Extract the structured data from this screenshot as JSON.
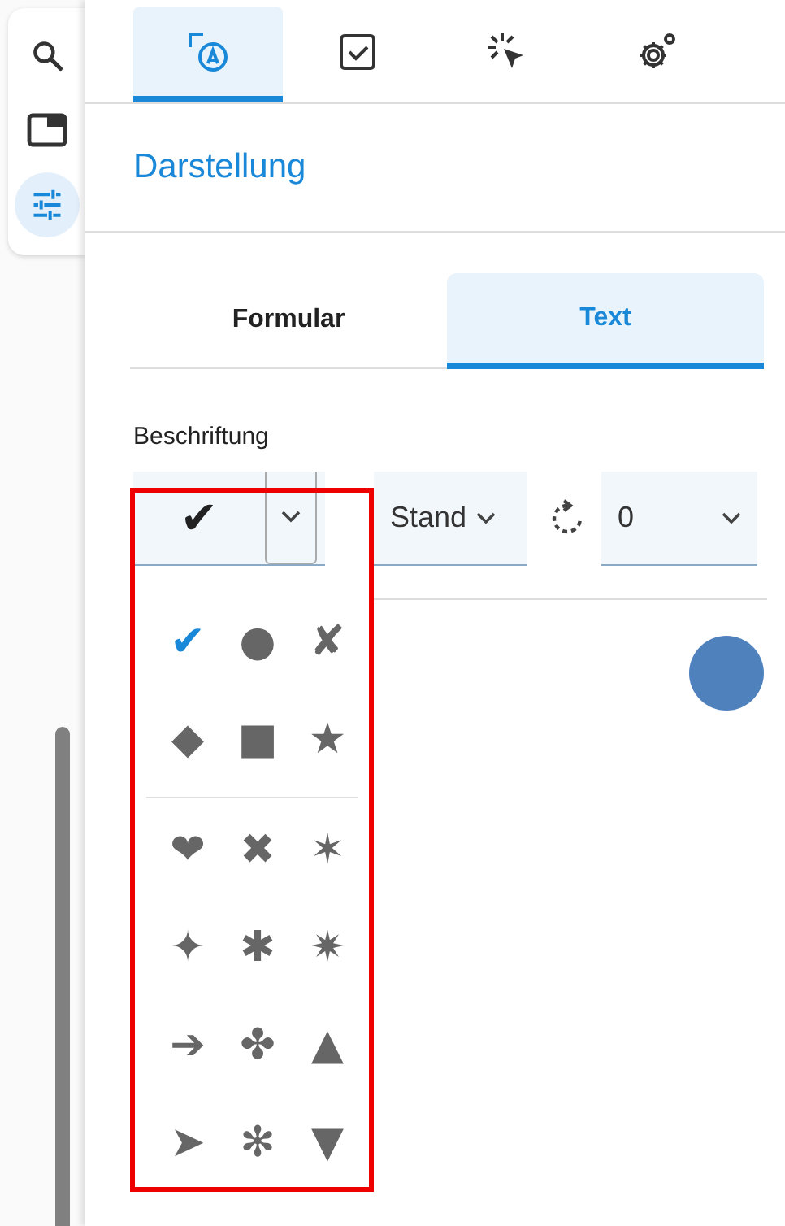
{
  "rail": {
    "items": [
      {
        "kind": "search",
        "selected": false
      },
      {
        "kind": "window",
        "selected": false
      },
      {
        "kind": "sliders",
        "selected": true
      }
    ]
  },
  "tabs": [
    {
      "kind": "appearance",
      "selected": true
    },
    {
      "kind": "checkbox",
      "selected": false
    },
    {
      "kind": "click",
      "selected": false
    },
    {
      "kind": "gears",
      "selected": false
    }
  ],
  "title": "Darstellung",
  "subtabs": [
    {
      "label": "Formular",
      "selected": false
    },
    {
      "label": "Text",
      "selected": true
    }
  ],
  "section_label": "Beschriftung",
  "symbol_select": {
    "value": "✔"
  },
  "style_select": {
    "value": "Stand"
  },
  "rotation_select": {
    "value": "0"
  },
  "color_swatch": {
    "color": "#4f81bd"
  },
  "symbol_menu": {
    "groups": [
      [
        {
          "symbol": "✔",
          "selected": true
        },
        {
          "symbol": "●",
          "selected": false
        },
        {
          "symbol": "✘",
          "selected": false
        },
        {
          "symbol": "◆",
          "selected": false
        },
        {
          "symbol": "■",
          "selected": false
        },
        {
          "symbol": "★",
          "selected": false
        }
      ],
      [
        {
          "symbol": "❤",
          "selected": false
        },
        {
          "symbol": "✖",
          "selected": false
        },
        {
          "symbol": "✶",
          "selected": false
        },
        {
          "symbol": "✦",
          "selected": false
        },
        {
          "symbol": "✱",
          "selected": false
        },
        {
          "symbol": "✷",
          "selected": false
        },
        {
          "symbol": "➔",
          "selected": false
        },
        {
          "symbol": "✤",
          "selected": false
        },
        {
          "symbol": "▲",
          "selected": false
        },
        {
          "symbol": "➤",
          "selected": false
        },
        {
          "symbol": "✻",
          "selected": false
        },
        {
          "symbol": "▼",
          "selected": false
        }
      ]
    ]
  }
}
